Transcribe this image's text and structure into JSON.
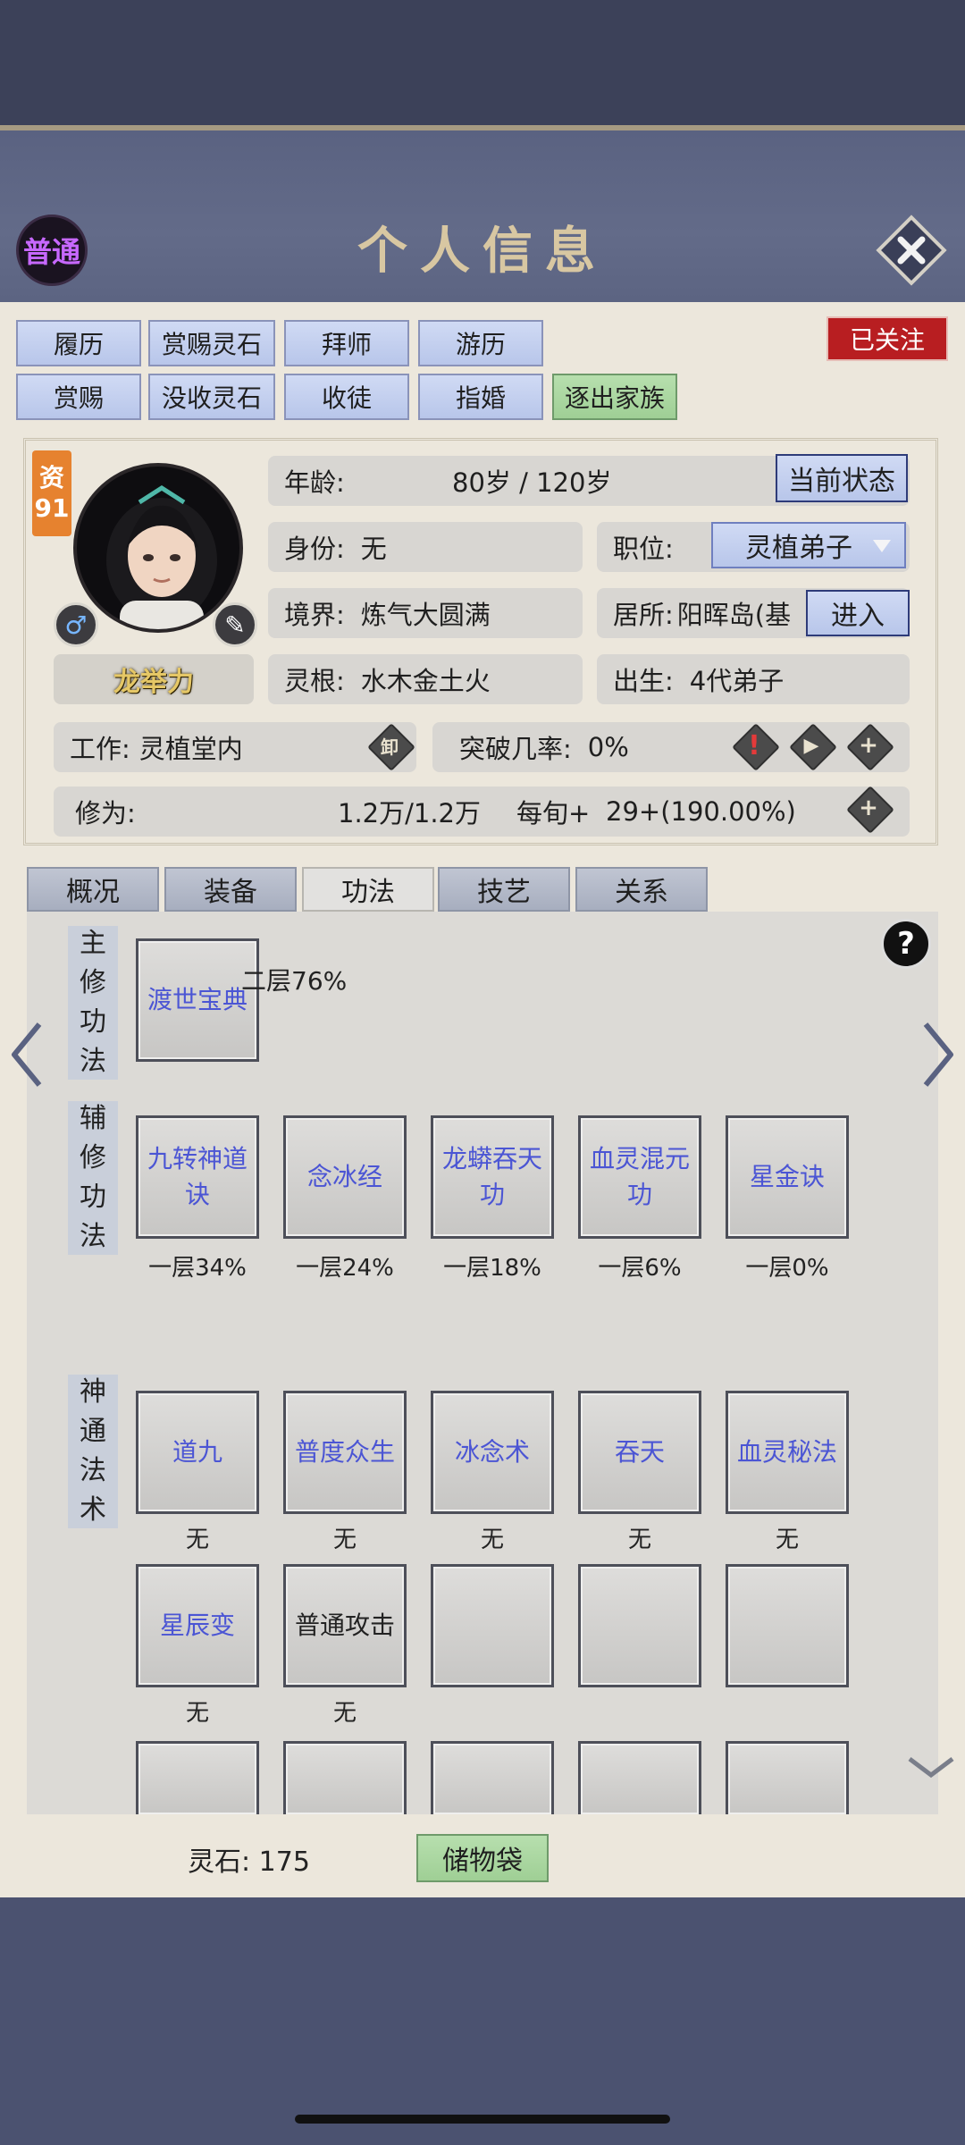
{
  "header": {
    "title": "个人信息",
    "badge_label": "普通",
    "close_icon": "close-icon"
  },
  "actions": {
    "row1": [
      "履历",
      "赏赐灵石",
      "拜师",
      "游历"
    ],
    "row2": [
      "赏赐",
      "没收灵石",
      "收徒",
      "指婚"
    ],
    "expel": "逐出家族",
    "follow": "已关注"
  },
  "character": {
    "aptitude_label": "资",
    "aptitude_value": "91",
    "name": "龙举力",
    "age_label": "年龄:",
    "age_value": "80岁 / 120岁",
    "status_button": "当前状态",
    "identity_label": "身份:",
    "identity_value": "无",
    "position_label": "职位:",
    "position_value": "灵植弟子",
    "realm_label": "境界:",
    "realm_value": "炼气大圆满",
    "residence_label": "居所:",
    "residence_value": "阳晖岛(基",
    "enter_button": "进入",
    "root_label": "灵根:",
    "root_value": "水木金土火",
    "birth_label": "出生:",
    "birth_value": "4代弟子",
    "work_label": "工作:",
    "work_value": "灵植堂内",
    "unload_glyph": "卸",
    "breakthrough_label": "突破几率:",
    "breakthrough_value": "0%",
    "cultivation_label": "修为:",
    "cultivation_value": "1.2万/1.2万",
    "per_period_label": "每旬+",
    "per_period_value": "29+(190.00%)"
  },
  "tabs": [
    "概况",
    "装备",
    "功法",
    "技艺",
    "关系"
  ],
  "active_tab": "功法",
  "techniques": {
    "main_label": [
      "主",
      "修",
      "功",
      "法"
    ],
    "main": {
      "name": "渡世宝典",
      "progress": "二层76%"
    },
    "aux_label": [
      "辅",
      "修",
      "功",
      "法"
    ],
    "aux": [
      {
        "name": "九转神道诀",
        "progress": "一层34%"
      },
      {
        "name": "念冰经",
        "progress": "一层24%"
      },
      {
        "name": "龙蟒吞天功",
        "progress": "一层18%"
      },
      {
        "name": "血灵混元功",
        "progress": "一层6%"
      },
      {
        "name": "星金诀",
        "progress": "一层0%"
      }
    ],
    "skill_label": [
      "神",
      "通",
      "法",
      "术"
    ],
    "skills": [
      {
        "name": "道九",
        "note": "无"
      },
      {
        "name": "普度众生",
        "note": "无"
      },
      {
        "name": "冰念术",
        "note": "无"
      },
      {
        "name": "吞天",
        "note": "无"
      },
      {
        "name": "血灵秘法",
        "note": "无"
      },
      {
        "name": "星辰变",
        "note": "无"
      },
      {
        "name": "普通攻击",
        "note": "无"
      }
    ],
    "help": "?"
  },
  "footer": {
    "stones_label": "灵石:",
    "stones_value": "175",
    "bag_button": "储物袋"
  },
  "colors": {
    "accent_blue_text": "#4b55d4",
    "follow_red": "#b81e21",
    "title_gold": "#d8c7a2",
    "badge_purple": "#c768ff"
  }
}
